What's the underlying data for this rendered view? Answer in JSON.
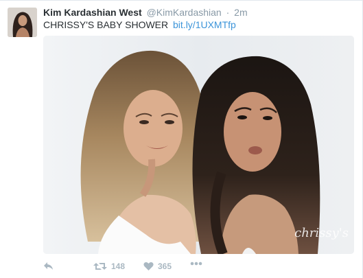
{
  "tweet": {
    "author": {
      "name": "Kim Kardashian West",
      "handle": "@KimKardashian",
      "separator": "·",
      "time": "2m"
    },
    "text": "CHRISSY'S BABY SHOWER",
    "link": "bit.ly/1UXMTfp",
    "photo": {
      "watermark": "chrissy's"
    },
    "actions": {
      "reply_icon": "reply-icon",
      "retweet_icon": "retweet-icon",
      "retweet_count": "148",
      "like_icon": "heart-icon",
      "like_count": "365",
      "more_icon": "more-icon"
    }
  },
  "colors": {
    "name": "#292f33",
    "meta": "#8899a6",
    "link": "#3b94d9",
    "icons": "#aab8c2"
  }
}
